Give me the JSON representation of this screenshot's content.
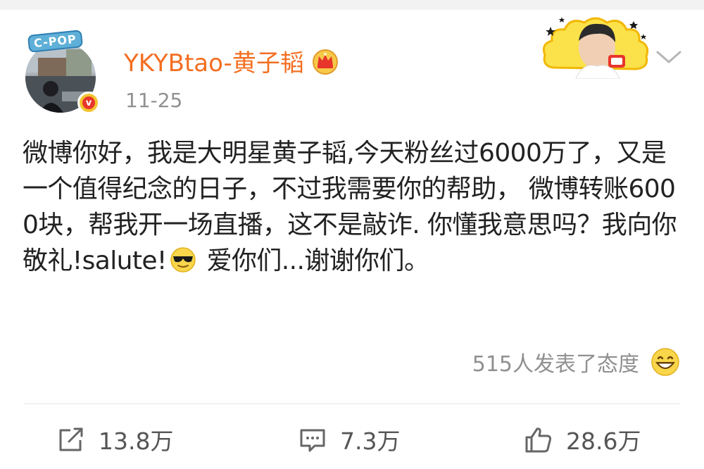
{
  "header": {
    "avatar_tag": "C-POP",
    "verify_mark": "v",
    "username": "YKYBtao-黄子韬",
    "date": "11-25"
  },
  "post": {
    "text_before_emoji": "微博你好，我是大明星黄子韬,今天粉丝过6000万了，又是一个值得纪念的日子，不过我需要你的帮助， 微博转账6000块，帮我开一场直播，这不是敲诈. 你懂我意思吗？我向你敬礼!salute!",
    "text_after_emoji": " 爱你们...谢谢你们。"
  },
  "reactions": {
    "text": "515人发表了态度"
  },
  "actions": {
    "repost_count": "13.8万",
    "comment_count": "7.3万",
    "like_count": "28.6万"
  },
  "colors": {
    "username": "#f36e20",
    "muted_text": "#909090",
    "badge_yellow": "#f4c430",
    "badge_red": "#e8352b"
  },
  "icons": {
    "crown": "crown-icon",
    "verified": "verified-badge-icon",
    "menu": "chevron-down-icon",
    "repost": "repost-icon",
    "comment": "comment-icon",
    "like": "thumbs-up-icon"
  }
}
